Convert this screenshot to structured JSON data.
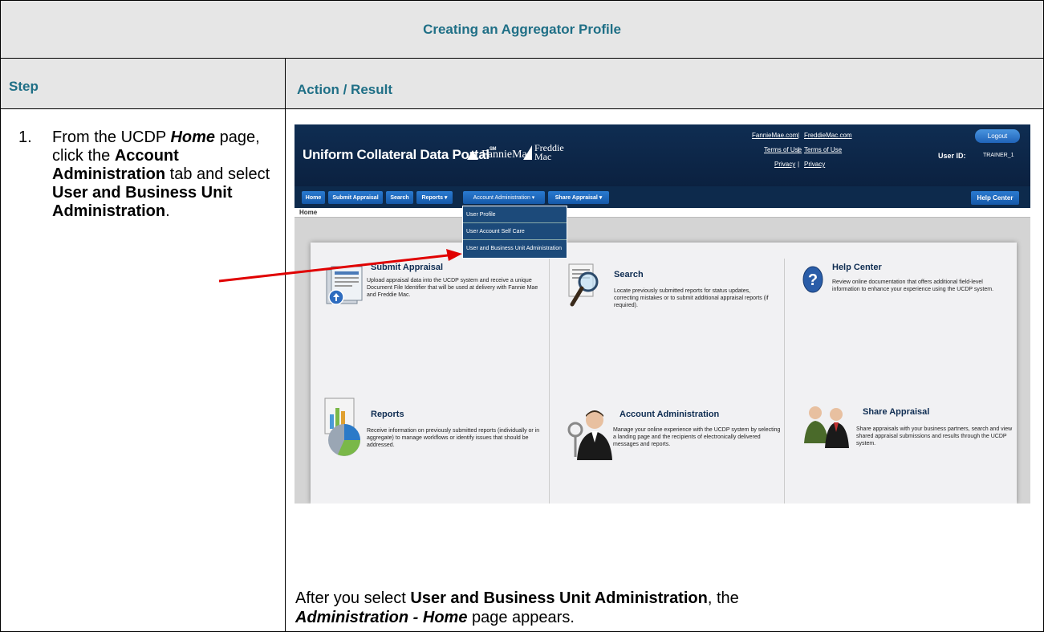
{
  "table": {
    "title": "Creating an Aggregator Profile",
    "col_step": "Step",
    "col_action": "Action / Result"
  },
  "step": {
    "number": "1.",
    "t1": "From the UCDP ",
    "t2": "Home",
    "t3": " page, click the ",
    "t4": "Account Administration",
    "t5": " tab and select ",
    "t6": "User and Business Unit Administration",
    "t7": "."
  },
  "result": {
    "t1": "After you select ",
    "t2": "User and Business Unit Administration",
    "t3": ", the ",
    "t4": "Administration - Home",
    "t5": " page appears."
  },
  "screenshot": {
    "portal_title": "Uniform Collateral Data Portal",
    "portal_sm": "SM",
    "fannie_logo": "FannieMae",
    "freddie_logo_1": "Freddie",
    "freddie_logo_2": "Mac",
    "link_fanniemae": "FannieMae.com",
    "link_freddiemac": "FreddieMac.com",
    "link_terms_1": "Terms of Use",
    "link_terms_2": "Terms of Use",
    "link_privacy_1": "Privacy",
    "link_privacy_2": "Privacy",
    "link_sep": "|",
    "logout": "Logout",
    "user_id_label": "User ID:",
    "user_id_value": "TRAINER_1",
    "nav": {
      "home": "Home",
      "submit": "Submit Appraisal",
      "search": "Search",
      "reports": "Reports ▾",
      "account_admin": "Account Administration ▾",
      "share": "Share Appraisal ▾",
      "help": "Help Center"
    },
    "breadcrumb": "Home",
    "dropdown": {
      "item1": "User Profile",
      "item2": "User Account Self Care",
      "item3": "User and Business Unit Administration"
    },
    "tiles": {
      "submit_title": "Submit Appraisal",
      "submit_desc": "Upload appraisal data into the UCDP system and receive a unique Document File Identifier that will be used at delivery with Fannie Mae and Freddie Mac.",
      "search_title": "Search",
      "search_desc": "Locate previously submitted reports for status updates, correcting mistakes or to submit additional appraisal reports (if required).",
      "help_title": "Help Center",
      "help_desc": "Review online documentation that offers additional field-level information to enhance your experience using the UCDP system.",
      "reports_title": "Reports",
      "reports_desc": "Receive information on previously submitted reports (individually or in aggregate) to manage workflows or identify issues that should be addressed.",
      "account_title": "Account Administration",
      "account_desc": "Manage your online experience with the UCDP system by selecting a landing page and the recipients of electronically delivered messages and reports.",
      "share_title": "Share Appraisal",
      "share_desc": "Share appraisals with your business partners, search and view shared appraisal submissions and results through the UCDP system."
    }
  },
  "colors": {
    "heading": "#1f6f86",
    "header_bg": "#e6e6e6",
    "portal_navy": "#0f2d52",
    "arrow": "#e00000"
  }
}
